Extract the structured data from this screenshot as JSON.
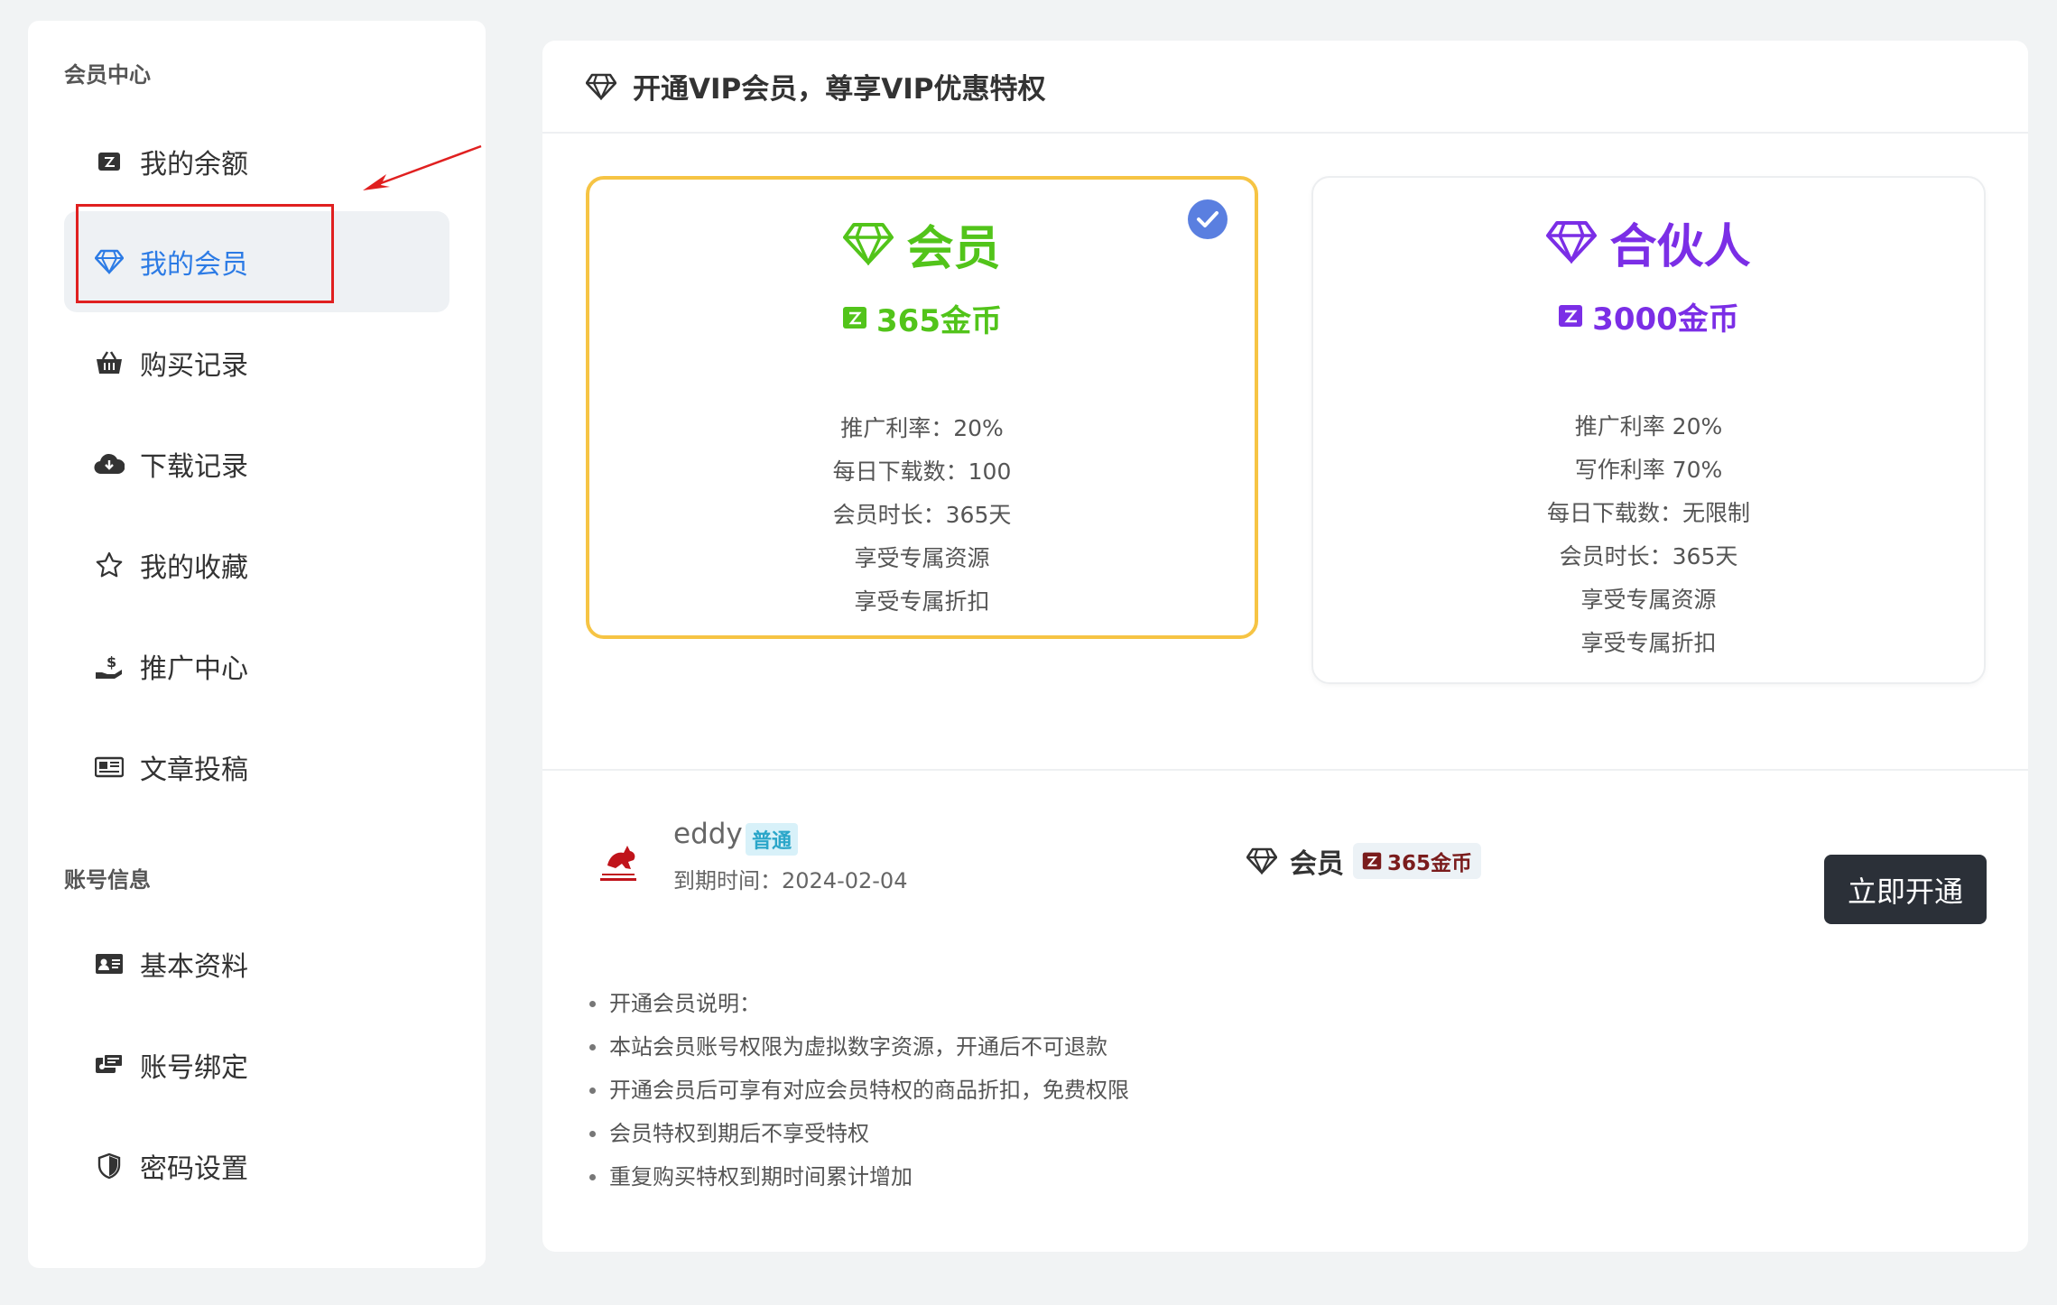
{
  "sidebar": {
    "section_member": "会员中心",
    "section_account": "账号信息",
    "items": [
      {
        "label": "我的余额",
        "icon": "wallet-icon"
      },
      {
        "label": "我的会员",
        "icon": "diamond-icon"
      },
      {
        "label": "购买记录",
        "icon": "basket-icon"
      },
      {
        "label": "下载记录",
        "icon": "cloud-download-icon"
      },
      {
        "label": "我的收藏",
        "icon": "star-icon"
      },
      {
        "label": "推广中心",
        "icon": "hand-dollar-icon"
      },
      {
        "label": "文章投稿",
        "icon": "newspaper-icon"
      },
      {
        "label": "基本资料",
        "icon": "id-card-icon"
      },
      {
        "label": "账号绑定",
        "icon": "account-link-icon"
      },
      {
        "label": "密码设置",
        "icon": "shield-icon"
      }
    ],
    "active_index": 1
  },
  "header": {
    "title": "开通VIP会员，尊享VIP优惠特权"
  },
  "plans": [
    {
      "name": "会员",
      "price": "365金币",
      "color": "#52c41a",
      "selected": true,
      "features": [
        "推广利率：20%",
        "每日下载数：100",
        "会员时长：365天",
        "享受专属资源",
        "享受专属折扣"
      ]
    },
    {
      "name": "合伙人",
      "price": "3000金币",
      "color": "#7b2ee6",
      "selected": false,
      "features": [
        "推广利率 20%",
        "写作利率 70%",
        "每日下载数：无限制",
        "会员时长：365天",
        "享受专属资源",
        "享受专属折扣"
      ]
    }
  ],
  "user": {
    "name": "eddy",
    "level_badge": "普通",
    "expire_text": "到期时间：2024-02-04"
  },
  "selected_plan": {
    "name": "会员",
    "price": "365金币"
  },
  "buy_button": "立即开通",
  "notes": [
    "开通会员说明：",
    "本站会员账号权限为虚拟数字资源，开通后不可退款",
    "开通会员后可享有对应会员特权的商品折扣，免费权限",
    "会员特权到期后不享受特权",
    "重复购买特权到期时间累计增加"
  ],
  "colors": {
    "accent_blue": "#2c7be5",
    "selected_border": "#f6c444",
    "button_dark": "#2b3038",
    "annotation_red": "#e02020"
  }
}
